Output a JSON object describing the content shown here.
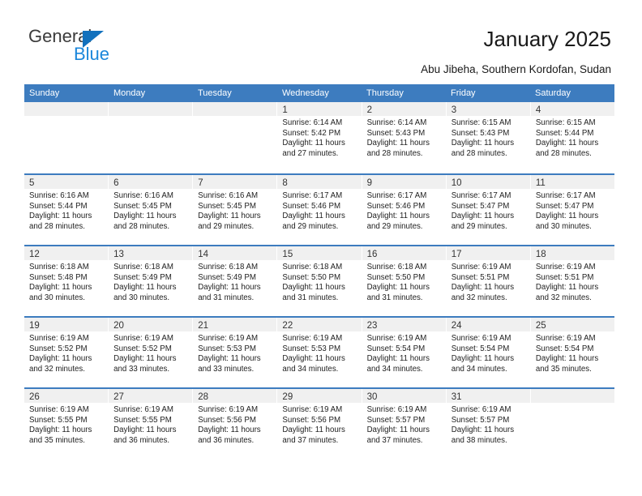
{
  "brand": {
    "name_part1": "General",
    "name_part2": "Blue",
    "color_dark": "#3b3b3b",
    "color_blue": "#1b87db",
    "triangle_color": "#1271bd"
  },
  "header": {
    "title": "January 2025",
    "subtitle": "Abu Jibeha, Southern Kordofan, Sudan"
  },
  "theme": {
    "header_bar": "#3d7cbf",
    "daynum_band": "#f0f0f0",
    "cell_background": "#ffffff",
    "text": "#222222"
  },
  "calendar": {
    "day_headers": [
      "Sunday",
      "Monday",
      "Tuesday",
      "Wednesday",
      "Thursday",
      "Friday",
      "Saturday"
    ],
    "weeks": [
      [
        {
          "day": "",
          "sunrise": "",
          "sunset": "",
          "daylight_line1": "",
          "daylight_line2": ""
        },
        {
          "day": "",
          "sunrise": "",
          "sunset": "",
          "daylight_line1": "",
          "daylight_line2": ""
        },
        {
          "day": "",
          "sunrise": "",
          "sunset": "",
          "daylight_line1": "",
          "daylight_line2": ""
        },
        {
          "day": "1",
          "sunrise": "Sunrise: 6:14 AM",
          "sunset": "Sunset: 5:42 PM",
          "daylight_line1": "Daylight: 11 hours",
          "daylight_line2": "and 27 minutes."
        },
        {
          "day": "2",
          "sunrise": "Sunrise: 6:14 AM",
          "sunset": "Sunset: 5:43 PM",
          "daylight_line1": "Daylight: 11 hours",
          "daylight_line2": "and 28 minutes."
        },
        {
          "day": "3",
          "sunrise": "Sunrise: 6:15 AM",
          "sunset": "Sunset: 5:43 PM",
          "daylight_line1": "Daylight: 11 hours",
          "daylight_line2": "and 28 minutes."
        },
        {
          "day": "4",
          "sunrise": "Sunrise: 6:15 AM",
          "sunset": "Sunset: 5:44 PM",
          "daylight_line1": "Daylight: 11 hours",
          "daylight_line2": "and 28 minutes."
        }
      ],
      [
        {
          "day": "5",
          "sunrise": "Sunrise: 6:16 AM",
          "sunset": "Sunset: 5:44 PM",
          "daylight_line1": "Daylight: 11 hours",
          "daylight_line2": "and 28 minutes."
        },
        {
          "day": "6",
          "sunrise": "Sunrise: 6:16 AM",
          "sunset": "Sunset: 5:45 PM",
          "daylight_line1": "Daylight: 11 hours",
          "daylight_line2": "and 28 minutes."
        },
        {
          "day": "7",
          "sunrise": "Sunrise: 6:16 AM",
          "sunset": "Sunset: 5:45 PM",
          "daylight_line1": "Daylight: 11 hours",
          "daylight_line2": "and 29 minutes."
        },
        {
          "day": "8",
          "sunrise": "Sunrise: 6:17 AM",
          "sunset": "Sunset: 5:46 PM",
          "daylight_line1": "Daylight: 11 hours",
          "daylight_line2": "and 29 minutes."
        },
        {
          "day": "9",
          "sunrise": "Sunrise: 6:17 AM",
          "sunset": "Sunset: 5:46 PM",
          "daylight_line1": "Daylight: 11 hours",
          "daylight_line2": "and 29 minutes."
        },
        {
          "day": "10",
          "sunrise": "Sunrise: 6:17 AM",
          "sunset": "Sunset: 5:47 PM",
          "daylight_line1": "Daylight: 11 hours",
          "daylight_line2": "and 29 minutes."
        },
        {
          "day": "11",
          "sunrise": "Sunrise: 6:17 AM",
          "sunset": "Sunset: 5:47 PM",
          "daylight_line1": "Daylight: 11 hours",
          "daylight_line2": "and 30 minutes."
        }
      ],
      [
        {
          "day": "12",
          "sunrise": "Sunrise: 6:18 AM",
          "sunset": "Sunset: 5:48 PM",
          "daylight_line1": "Daylight: 11 hours",
          "daylight_line2": "and 30 minutes."
        },
        {
          "day": "13",
          "sunrise": "Sunrise: 6:18 AM",
          "sunset": "Sunset: 5:49 PM",
          "daylight_line1": "Daylight: 11 hours",
          "daylight_line2": "and 30 minutes."
        },
        {
          "day": "14",
          "sunrise": "Sunrise: 6:18 AM",
          "sunset": "Sunset: 5:49 PM",
          "daylight_line1": "Daylight: 11 hours",
          "daylight_line2": "and 31 minutes."
        },
        {
          "day": "15",
          "sunrise": "Sunrise: 6:18 AM",
          "sunset": "Sunset: 5:50 PM",
          "daylight_line1": "Daylight: 11 hours",
          "daylight_line2": "and 31 minutes."
        },
        {
          "day": "16",
          "sunrise": "Sunrise: 6:18 AM",
          "sunset": "Sunset: 5:50 PM",
          "daylight_line1": "Daylight: 11 hours",
          "daylight_line2": "and 31 minutes."
        },
        {
          "day": "17",
          "sunrise": "Sunrise: 6:19 AM",
          "sunset": "Sunset: 5:51 PM",
          "daylight_line1": "Daylight: 11 hours",
          "daylight_line2": "and 32 minutes."
        },
        {
          "day": "18",
          "sunrise": "Sunrise: 6:19 AM",
          "sunset": "Sunset: 5:51 PM",
          "daylight_line1": "Daylight: 11 hours",
          "daylight_line2": "and 32 minutes."
        }
      ],
      [
        {
          "day": "19",
          "sunrise": "Sunrise: 6:19 AM",
          "sunset": "Sunset: 5:52 PM",
          "daylight_line1": "Daylight: 11 hours",
          "daylight_line2": "and 32 minutes."
        },
        {
          "day": "20",
          "sunrise": "Sunrise: 6:19 AM",
          "sunset": "Sunset: 5:52 PM",
          "daylight_line1": "Daylight: 11 hours",
          "daylight_line2": "and 33 minutes."
        },
        {
          "day": "21",
          "sunrise": "Sunrise: 6:19 AM",
          "sunset": "Sunset: 5:53 PM",
          "daylight_line1": "Daylight: 11 hours",
          "daylight_line2": "and 33 minutes."
        },
        {
          "day": "22",
          "sunrise": "Sunrise: 6:19 AM",
          "sunset": "Sunset: 5:53 PM",
          "daylight_line1": "Daylight: 11 hours",
          "daylight_line2": "and 34 minutes."
        },
        {
          "day": "23",
          "sunrise": "Sunrise: 6:19 AM",
          "sunset": "Sunset: 5:54 PM",
          "daylight_line1": "Daylight: 11 hours",
          "daylight_line2": "and 34 minutes."
        },
        {
          "day": "24",
          "sunrise": "Sunrise: 6:19 AM",
          "sunset": "Sunset: 5:54 PM",
          "daylight_line1": "Daylight: 11 hours",
          "daylight_line2": "and 34 minutes."
        },
        {
          "day": "25",
          "sunrise": "Sunrise: 6:19 AM",
          "sunset": "Sunset: 5:54 PM",
          "daylight_line1": "Daylight: 11 hours",
          "daylight_line2": "and 35 minutes."
        }
      ],
      [
        {
          "day": "26",
          "sunrise": "Sunrise: 6:19 AM",
          "sunset": "Sunset: 5:55 PM",
          "daylight_line1": "Daylight: 11 hours",
          "daylight_line2": "and 35 minutes."
        },
        {
          "day": "27",
          "sunrise": "Sunrise: 6:19 AM",
          "sunset": "Sunset: 5:55 PM",
          "daylight_line1": "Daylight: 11 hours",
          "daylight_line2": "and 36 minutes."
        },
        {
          "day": "28",
          "sunrise": "Sunrise: 6:19 AM",
          "sunset": "Sunset: 5:56 PM",
          "daylight_line1": "Daylight: 11 hours",
          "daylight_line2": "and 36 minutes."
        },
        {
          "day": "29",
          "sunrise": "Sunrise: 6:19 AM",
          "sunset": "Sunset: 5:56 PM",
          "daylight_line1": "Daylight: 11 hours",
          "daylight_line2": "and 37 minutes."
        },
        {
          "day": "30",
          "sunrise": "Sunrise: 6:19 AM",
          "sunset": "Sunset: 5:57 PM",
          "daylight_line1": "Daylight: 11 hours",
          "daylight_line2": "and 37 minutes."
        },
        {
          "day": "31",
          "sunrise": "Sunrise: 6:19 AM",
          "sunset": "Sunset: 5:57 PM",
          "daylight_line1": "Daylight: 11 hours",
          "daylight_line2": "and 38 minutes."
        },
        {
          "day": "",
          "sunrise": "",
          "sunset": "",
          "daylight_line1": "",
          "daylight_line2": ""
        }
      ]
    ]
  }
}
